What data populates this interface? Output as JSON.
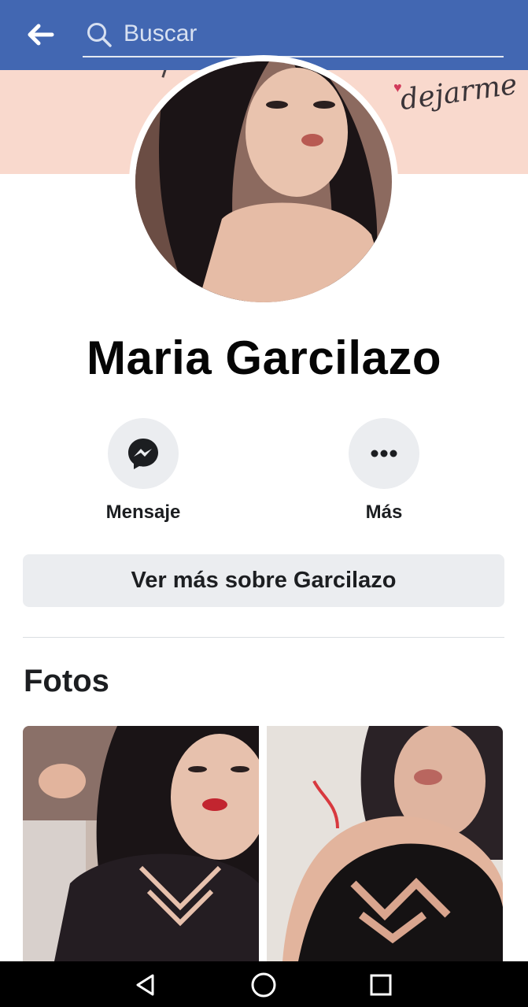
{
  "header": {
    "back_icon": "arrow-left-icon",
    "search_icon": "search-icon",
    "search_placeholder": "Buscar",
    "background": "#4267b2"
  },
  "cover": {
    "text": "dejarme",
    "background": "#f9d9cd"
  },
  "profile": {
    "name": "Maria Garcilazo"
  },
  "actions": [
    {
      "label": "Mensaje",
      "icon": "messenger-icon"
    },
    {
      "label": "Más",
      "icon": "more-dots-icon"
    }
  ],
  "see_more_button": "Ver más sobre Garcilazo",
  "photos": {
    "title": "Fotos",
    "items": [
      {
        "alt": "photo-1"
      },
      {
        "alt": "photo-2"
      }
    ]
  },
  "system_nav": {
    "back_icon": "triangle-back-icon",
    "home_icon": "circle-home-icon",
    "recent_icon": "square-recents-icon"
  }
}
